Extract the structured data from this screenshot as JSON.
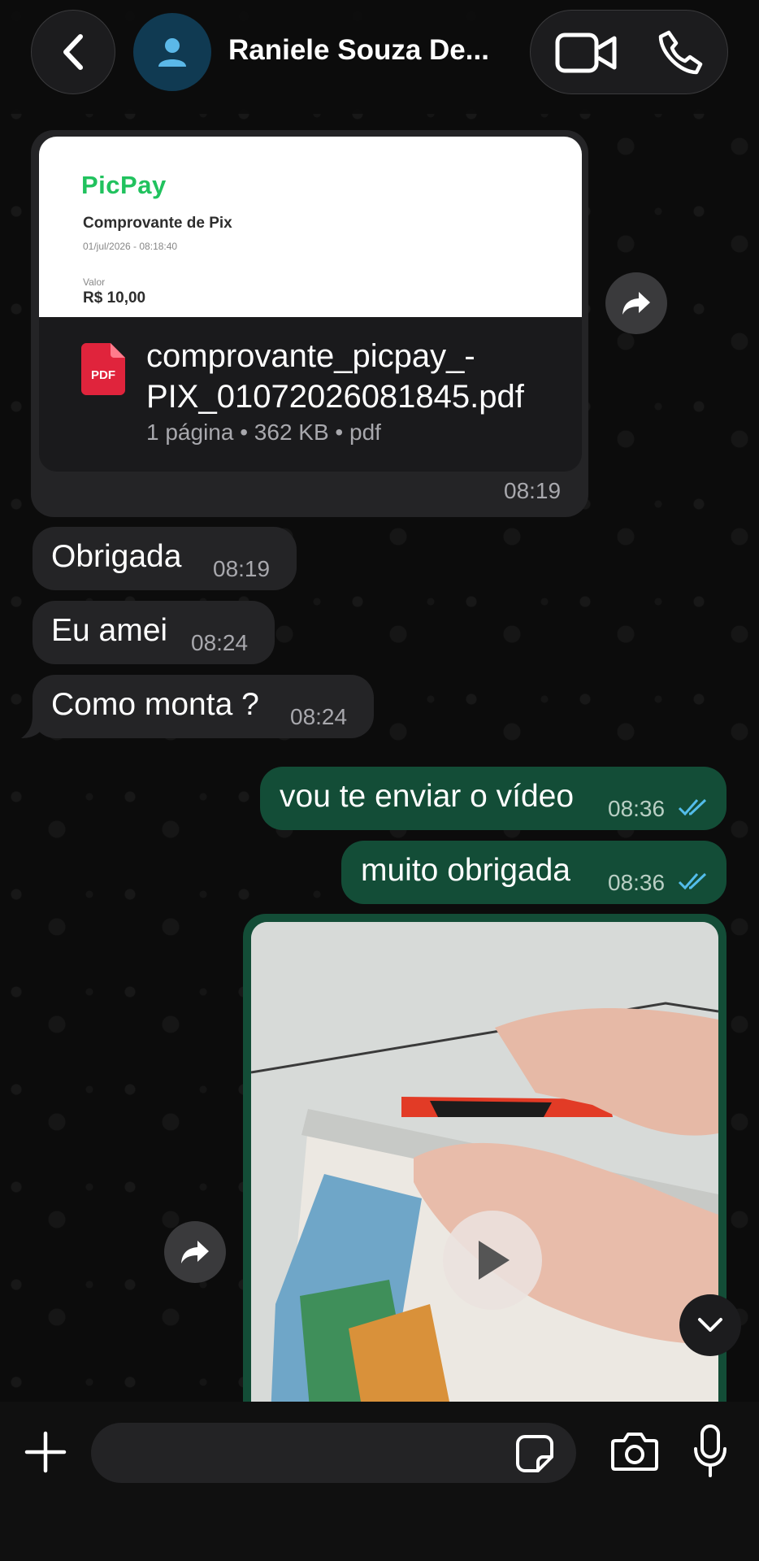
{
  "header": {
    "contact_name": "Raniele Souza De..."
  },
  "document_message": {
    "preview": {
      "brand": "PicPay",
      "title": "Comprovante de Pix",
      "date": "01/jul/2026 - 08:18:40",
      "valor_label": "Valor",
      "valor": "R$ 10,00"
    },
    "file_type_badge": "PDF",
    "file_name": "comprovante_picpay_-PIX_01072026081845.pdf",
    "meta": "1 página • 362 KB • pdf",
    "time": "08:19"
  },
  "messages": [
    {
      "direction": "in",
      "text": "Obrigada",
      "time": "08:19"
    },
    {
      "direction": "in",
      "text": "Eu amei",
      "time": "08:24"
    },
    {
      "direction": "in",
      "text": "Como monta ?",
      "time": "08:24"
    },
    {
      "direction": "out",
      "text": "vou te enviar o vídeo",
      "time": "08:36",
      "status": "read"
    },
    {
      "direction": "out",
      "text": "muito obrigada",
      "time": "08:36",
      "status": "read"
    }
  ],
  "composer": {
    "placeholder": ""
  },
  "colors": {
    "incoming_bubble": "#242426",
    "outgoing_bubble": "#134d37",
    "read_ticks": "#53bdeb",
    "background": "#0c0c0c"
  },
  "icons": [
    "chevron-left-icon",
    "person-icon",
    "video-camera-icon",
    "phone-icon",
    "forward-icon",
    "pdf-icon",
    "play-icon",
    "chevron-down-icon",
    "plus-icon",
    "sticker-icon",
    "camera-icon",
    "microphone-icon"
  ]
}
